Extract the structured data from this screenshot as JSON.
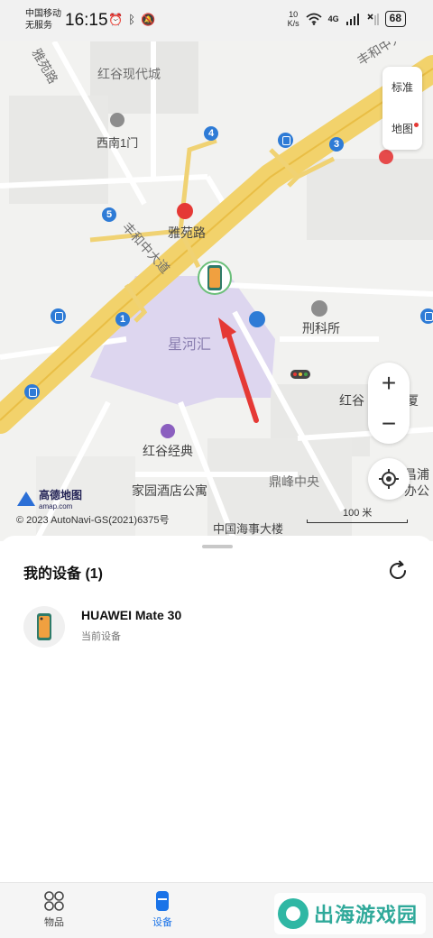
{
  "status_bar": {
    "carrier_line1": "中国移动",
    "carrier_line2": "无服务",
    "time": "16:15",
    "net_speed_value": "10",
    "net_speed_unit": "K/s",
    "signal_label": "4G",
    "battery": "68"
  },
  "map": {
    "labels": {
      "hongu_modern": "红谷现代城",
      "yayuan_road_north": "雅苑路",
      "ximen_gate": "西南1门",
      "fenghe_middle_top": "丰和中大道",
      "fenghe_middle_left": "丰和中大道",
      "yayuan_road": "雅苑路",
      "xinghe": "星河汇",
      "police": "刑科所",
      "hongu_jingdian": "红谷经典",
      "jiayuan_hotel": "家园酒店公寓",
      "dingfeng": "鼎峰中央",
      "hongu_partial": "红谷",
      "hongu_partial2": "厦",
      "changpu": "昌浦",
      "office": "办公",
      "haishi": "中国海事大楼"
    },
    "metro_stations": [
      "4",
      "3",
      "5",
      "1"
    ],
    "mode_buttons": {
      "standard": "标准",
      "layers": "地图"
    },
    "zoom": {
      "in": "+",
      "out": "−"
    },
    "brand": "高德地图",
    "brand_sub": "amap.com",
    "copyright": "© 2023 AutoNavi-GS(2021)6375号",
    "scale": "100 米"
  },
  "sheet": {
    "title": "我的设备 (1)",
    "devices": [
      {
        "name": "HUAWEI Mate 30",
        "subtitle": "当前设备"
      }
    ]
  },
  "bottom_nav": {
    "items": [
      {
        "label": "物品",
        "active": false
      },
      {
        "label": "设备",
        "active": true
      }
    ]
  },
  "watermark": "出海游戏园",
  "colors": {
    "accent": "#1a73e8",
    "road_major": "#f2d26b",
    "poi_blue": "#2e7bd6",
    "area_purple": "#ddd6ef",
    "direction_arrow": "#e53935"
  }
}
